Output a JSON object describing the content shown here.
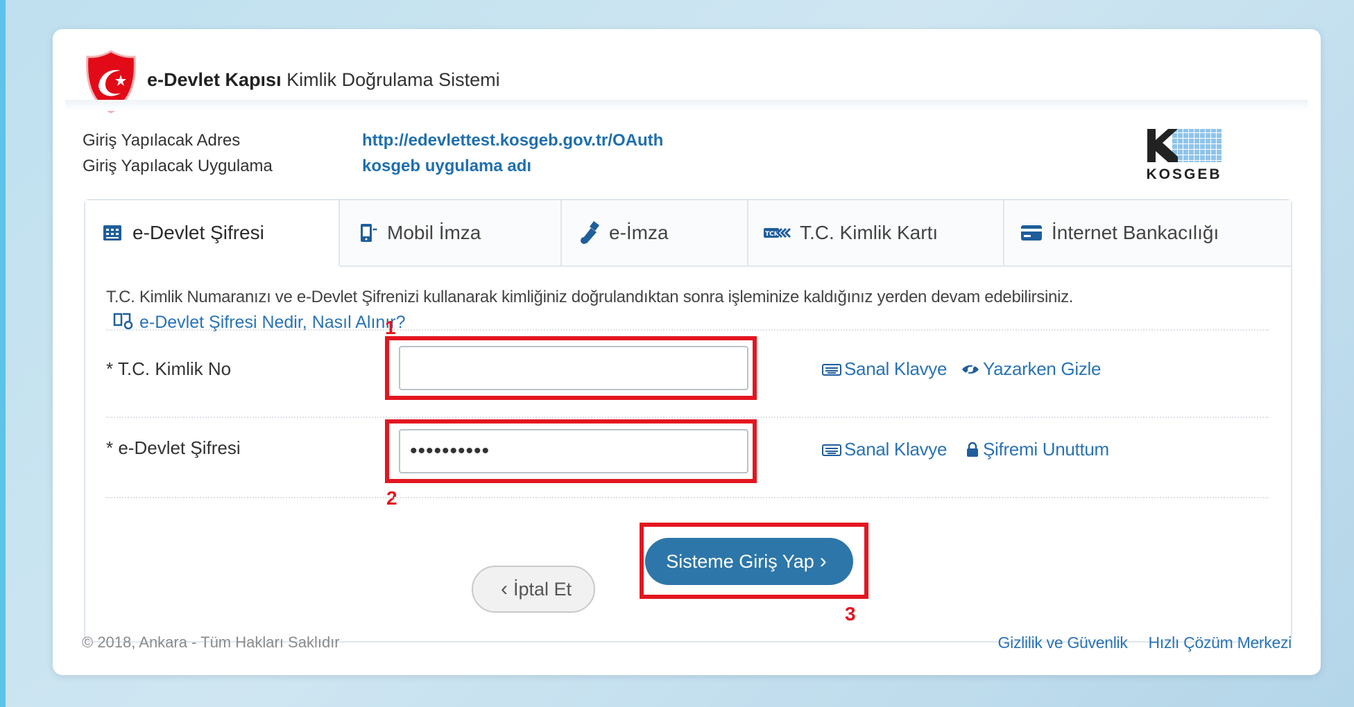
{
  "header": {
    "brand_bold": "e-Devlet Kapısı",
    "brand_rest": " Kimlik Doğrulama Sistemi"
  },
  "info": {
    "address_label": "Giriş Yapılacak Adres",
    "address_value": "http://edevlettest.kosgeb.gov.tr/OAuth",
    "app_label": "Giriş Yapılacak Uygulama",
    "app_value": "kosgeb uygulama adı"
  },
  "kosgeb_logo_text": "KOSGEB",
  "tabs": [
    {
      "label": "e-Devlet Şifresi",
      "icon": "keypad-icon",
      "active": true
    },
    {
      "label": "Mobil İmza",
      "icon": "mobile-icon",
      "active": false
    },
    {
      "label": "e-İmza",
      "icon": "usb-token-icon",
      "active": false
    },
    {
      "label": "T.C. Kimlik Kartı",
      "icon": "id-card-icon",
      "active": false
    },
    {
      "label": "İnternet Bankacılığı",
      "icon": "bank-card-icon",
      "active": false
    }
  ],
  "content": {
    "description": "T.C. Kimlik Numaranızı ve e-Devlet Şifrenizi kullanarak kimliğiniz doğrulandıktan sonra işleminize kaldığınız yerden devam edebilirsiniz.",
    "help_link": "e-Devlet Şifresi Nedir, Nasıl Alınır?"
  },
  "form": {
    "tc_label": "* T.C. Kimlik No",
    "tc_value": "",
    "password_label": "* e-Devlet Şifresi",
    "password_value": "••••••••••",
    "virtual_keyboard": "Sanal Klavye",
    "hide_while_typing": "Yazarken Gizle",
    "forgot_password": "Şifremi Unuttum"
  },
  "annotations": {
    "n1": "1",
    "n2": "2",
    "n3": "3",
    "color": "#e3161f"
  },
  "buttons": {
    "cancel": "İptal Et",
    "login": "Sisteme Giriş Yap"
  },
  "footer": {
    "copyright": "© 2018, Ankara - Tüm Hakları Saklıdır",
    "privacy": "Gizlilik ve Güvenlik",
    "support": "Hızlı Çözüm Merkezi"
  },
  "colors": {
    "accent": "#2d76a9",
    "link": "#2a73b5",
    "logo_red": "#e30a17"
  }
}
